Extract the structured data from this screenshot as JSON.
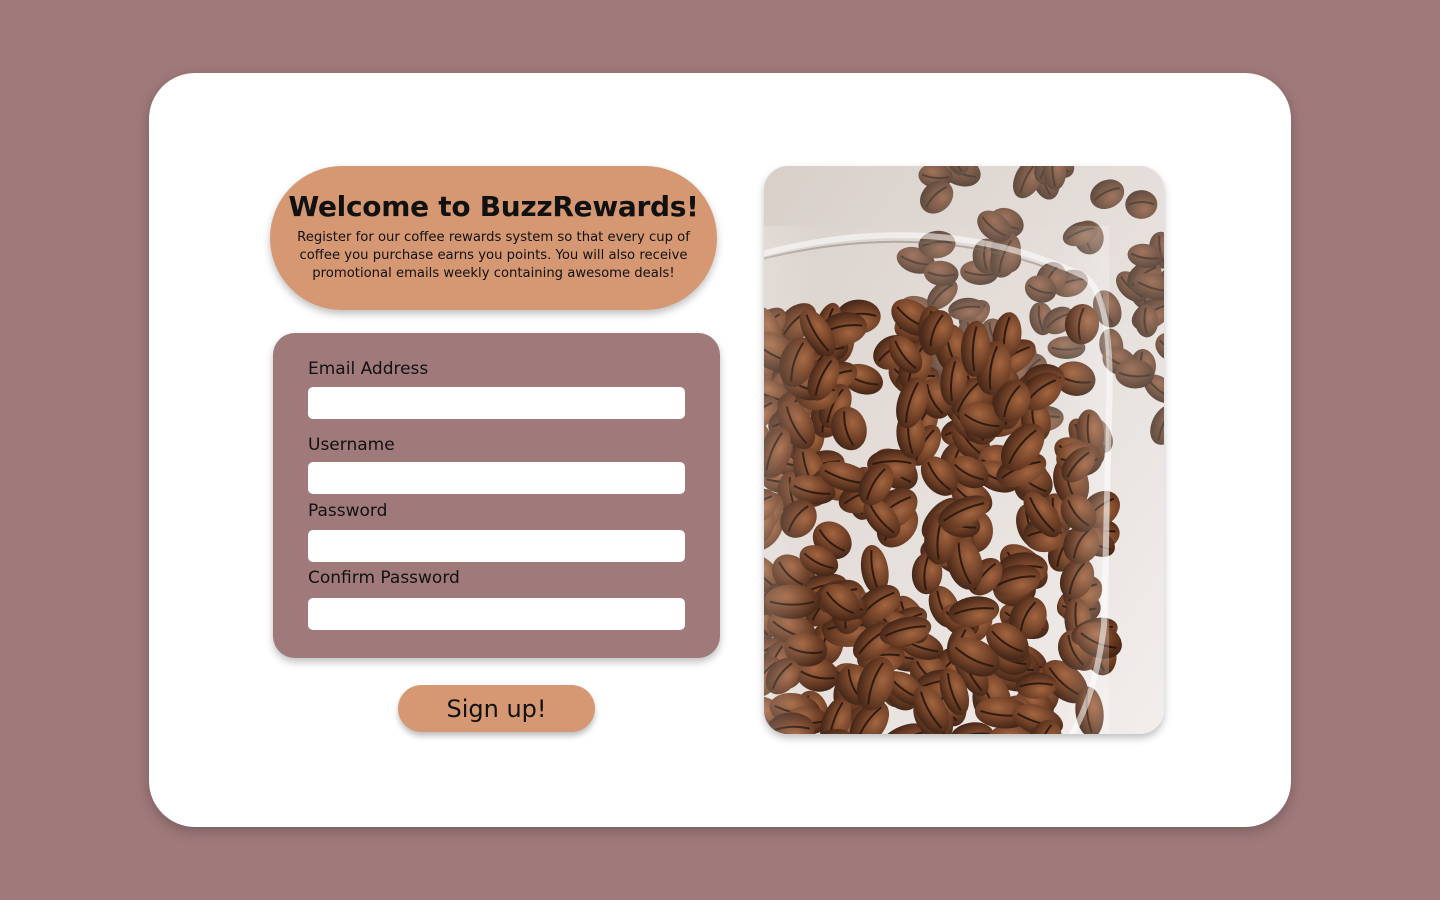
{
  "welcome": {
    "title": "Welcome to BuzzRewards!",
    "description": "Register for our coffee rewards system so that every cup of coffee you purchase earns you points. You will also receive promotional emails weekly containing awesome deals!"
  },
  "form": {
    "email_label": "Email Address",
    "username_label": "Username",
    "password_label": "Password",
    "confirm_password_label": "Confirm Password",
    "email_value": "",
    "username_value": "",
    "password_value": "",
    "confirm_password_value": ""
  },
  "signup_button": {
    "label": "Sign up!"
  },
  "colors": {
    "page_background": "#a07a7b",
    "card_background": "#ffffff",
    "accent": "#d69872",
    "form_background": "#a07a7b"
  }
}
